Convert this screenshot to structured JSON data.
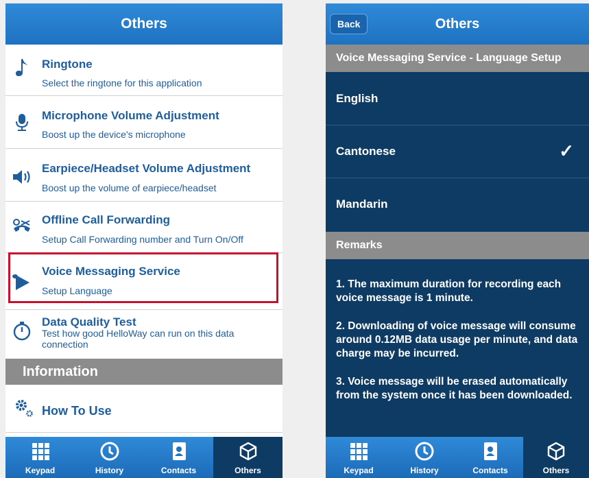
{
  "left": {
    "title": "Others",
    "items": [
      {
        "title": "Ringtone",
        "subtitle": "Select the ringtone for this application",
        "icon": "music-note-icon"
      },
      {
        "title": "Microphone Volume Adjustment",
        "subtitle": "Boost up the device's microphone",
        "icon": "microphone-icon"
      },
      {
        "title": "Earpiece/Headset Volume Adjustment",
        "subtitle": "Boost up the volume of earpiece/headset",
        "icon": "speaker-icon"
      },
      {
        "title": "Offline Call Forwarding",
        "subtitle": "Setup Call Forwarding number and Turn On/Off",
        "icon": "call-forwarding-icon"
      },
      {
        "title": "Voice Messaging Service",
        "subtitle": "Setup Language",
        "icon": "voice-message-icon"
      },
      {
        "title": "Data Quality Test",
        "subtitle": "Test how good HelloWay can run on this data connection",
        "icon": "stopwatch-icon"
      }
    ],
    "section_information": "Information",
    "how_to_use": "How To Use"
  },
  "right": {
    "back": "Back",
    "title": "Others",
    "header": "Voice Messaging Service - Language Setup",
    "languages": [
      "English",
      "Cantonese",
      "Mandarin"
    ],
    "selected": "Cantonese",
    "checkmark": "✓",
    "remarks_title": "Remarks",
    "remarks": [
      "1. The maximum duration for recording each voice message is 1 minute.",
      "2. Downloading of voice message will consume around 0.12MB data usage per minute, and data charge may be incurred.",
      "3. Voice message will be erased automatically from the system once it has been downloaded."
    ]
  },
  "tabs": [
    {
      "label": "Keypad",
      "icon": "keypad-icon"
    },
    {
      "label": "History",
      "icon": "clock-icon"
    },
    {
      "label": "Contacts",
      "icon": "contacts-icon"
    },
    {
      "label": "Others",
      "icon": "others-icon",
      "active": true
    }
  ],
  "colors": {
    "bar_blue": "#1e72c1",
    "dark_navy": "#0d3b64",
    "link_blue": "#1e5d9e",
    "highlight_red": "#c8102e",
    "section_gray": "#8c8c8c"
  }
}
